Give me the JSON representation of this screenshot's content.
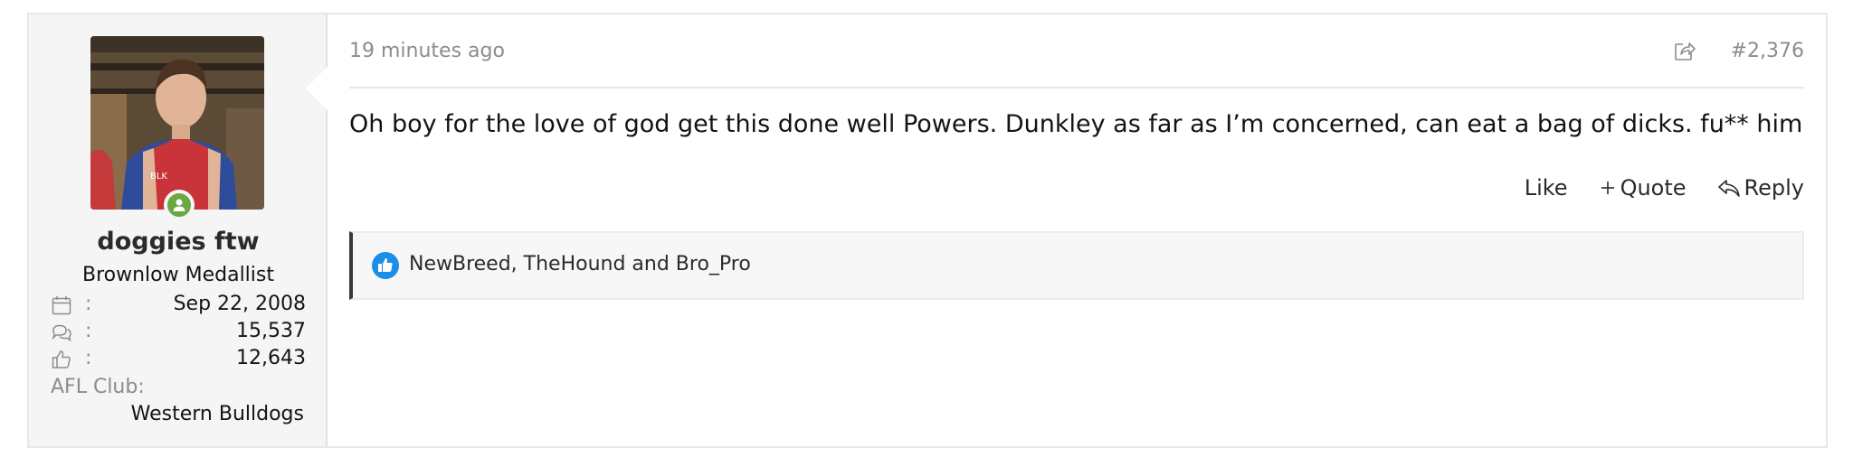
{
  "user": {
    "username": "doggies ftw",
    "title": "Brownlow Medallist",
    "stats": [
      {
        "icon": "calendar-icon",
        "label": ":",
        "value": "Sep 22, 2008"
      },
      {
        "icon": "messages-icon",
        "label": ":",
        "value": "15,537"
      },
      {
        "icon": "thumbs-up-icon",
        "label": ":",
        "value": "12,643"
      }
    ],
    "club_label": "AFL Club:",
    "club_value": "Western Bulldogs"
  },
  "post": {
    "timestamp": "19 minutes ago",
    "number": "#2,376",
    "message": "Oh boy for the love of god get this done well Powers. Dunkley as far as I’m concerned, can eat a bag of dicks. fu** him",
    "actions": {
      "like": "Like",
      "quote": "Quote",
      "reply": "Reply"
    },
    "reactions_text": "NewBreed, TheHound and Bro_Pro"
  },
  "colors": {
    "online": "#6aa842",
    "like_blue": "#1b8ee6",
    "text": "#141414",
    "muted": "#8c8c8c"
  }
}
